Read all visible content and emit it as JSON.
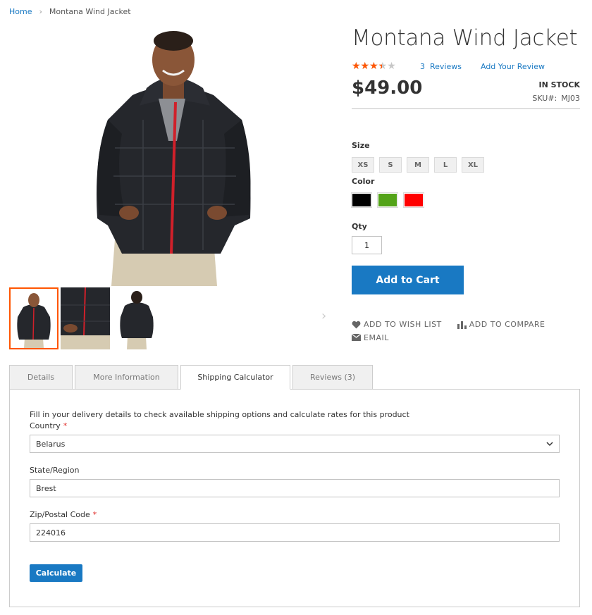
{
  "breadcrumb": {
    "home": "Home",
    "separator": "›",
    "current": "Montana Wind Jacket"
  },
  "product": {
    "title": "Montana Wind Jacket",
    "rating_fraction": 0.6,
    "stars_glyphs": "★★★★★",
    "reviews_count": "3",
    "reviews_label": "Reviews",
    "add_review": "Add Your Review",
    "price": "$49.00",
    "stock": "IN STOCK",
    "sku_label": "SKU#:",
    "sku_value": "MJ03"
  },
  "options": {
    "size_label": "Size",
    "sizes": [
      "XS",
      "S",
      "M",
      "L",
      "XL"
    ],
    "color_label": "Color",
    "colors": [
      "#000000",
      "#53a318",
      "#ff0000"
    ],
    "qty_label": "Qty",
    "qty_value": "1"
  },
  "buttons": {
    "add_to_cart": "Add to Cart",
    "next_arrow": "›"
  },
  "actions": {
    "wish_list": "Add to Wish List",
    "compare": "Add to Compare",
    "email": "Email"
  },
  "tabs": [
    {
      "label": "Details"
    },
    {
      "label": "More Information"
    },
    {
      "label": "Shipping Calculator"
    },
    {
      "label": "Reviews (3)"
    }
  ],
  "shipping": {
    "intro": "Fill in your delivery details to check available shipping options and calculate rates for this product",
    "country_label": "Country",
    "country_value": "Belarus",
    "region_label": "State/Region",
    "region_value": "Brest",
    "zip_label": "Zip/Postal Code",
    "zip_value": "224016",
    "required_mark": "*",
    "calculate": "Calculate"
  },
  "colors": {
    "accent": "#1979c3",
    "star": "#ff5501",
    "required": "#e02b27"
  },
  "icons": [
    "chevron-right-icon",
    "heart-icon",
    "bar-chart-icon",
    "envelope-icon",
    "chevron-down-icon"
  ]
}
